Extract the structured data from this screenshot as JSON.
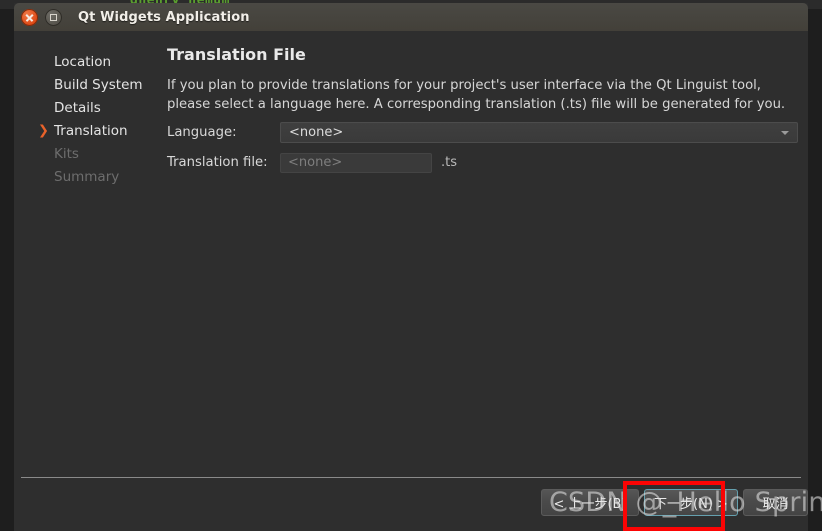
{
  "background": {
    "terminal_text": "qhenry nemum"
  },
  "window": {
    "title": "Qt Widgets Application",
    "close_icon": "close-icon",
    "maximize_icon": "maximize-icon"
  },
  "sidebar": {
    "items": [
      {
        "label": "Location",
        "state": "done",
        "arrow": ""
      },
      {
        "label": "Build System",
        "state": "done",
        "arrow": ""
      },
      {
        "label": "Details",
        "state": "done",
        "arrow": ""
      },
      {
        "label": "Translation",
        "state": "current",
        "arrow": "❯"
      },
      {
        "label": "Kits",
        "state": "disabled",
        "arrow": ""
      },
      {
        "label": "Summary",
        "state": "disabled",
        "arrow": ""
      }
    ]
  },
  "main": {
    "title": "Translation File",
    "description": "If you plan to provide translations for your project's user interface via the Qt Linguist tool, please select a language here. A corresponding translation (.ts) file will be generated for you.",
    "form": {
      "language_label": "Language:",
      "language_value": "<none>",
      "translation_file_label": "Translation file:",
      "translation_file_placeholder": "<none>",
      "translation_file_suffix": ".ts"
    }
  },
  "footer": {
    "back_label": "< 上一步(B)",
    "next_label": "下一步(N) >",
    "cancel_label": "取消"
  },
  "annotation": {
    "watermark": "CSDN @_Hello Spring",
    "highlight_color": "#fb0404"
  }
}
